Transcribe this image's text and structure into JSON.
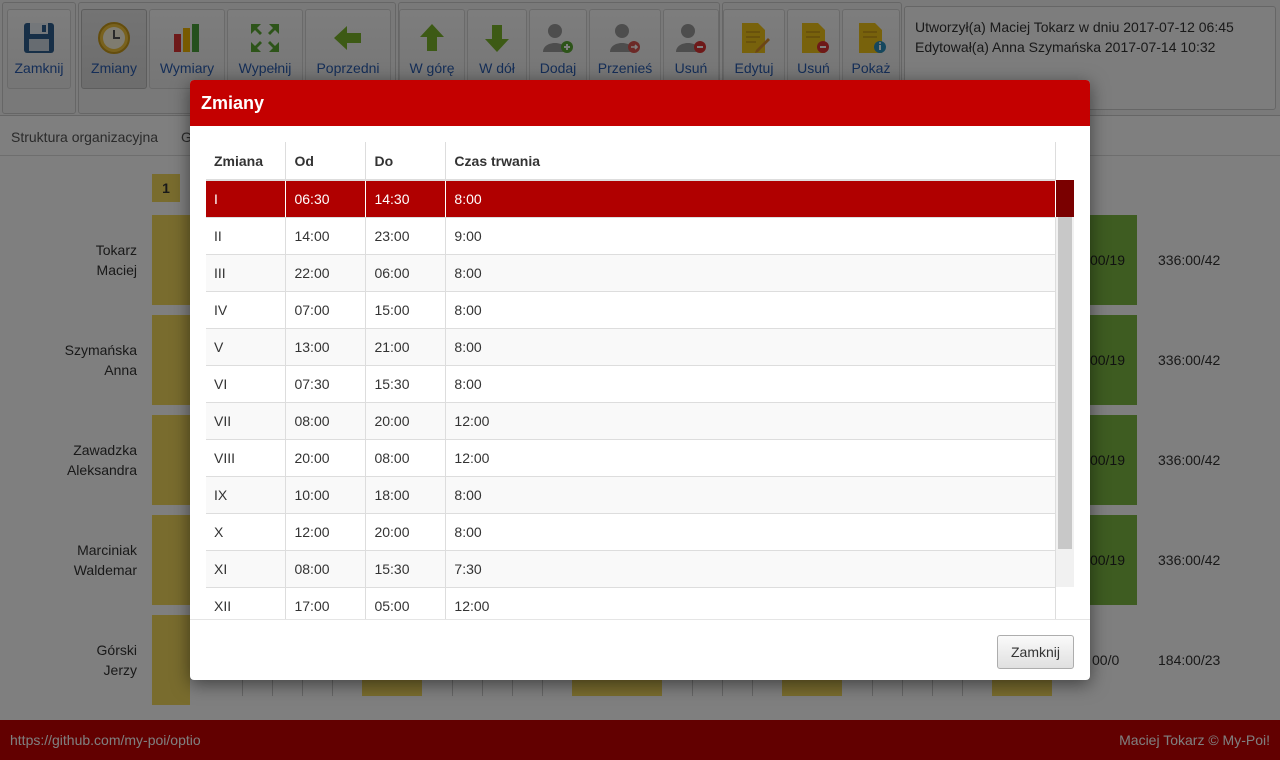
{
  "toolbar": {
    "buttons": [
      {
        "label": "Zamknij",
        "icon": "floppy-disk-icon"
      },
      {
        "label": "Zmiany",
        "icon": "clock-icon"
      },
      {
        "label": "Wymiary",
        "icon": "bar-chart-icon"
      },
      {
        "label": "Wypełnij",
        "icon": "expand-arrows-icon"
      },
      {
        "label": "Poprzedni",
        "icon": "arrow-left-icon"
      },
      {
        "label": "W górę",
        "icon": "arrow-up-icon"
      },
      {
        "label": "W dół",
        "icon": "arrow-down-icon"
      },
      {
        "label": "Dodaj",
        "icon": "user-add-icon"
      },
      {
        "label": "Przenieś",
        "icon": "user-move-icon"
      },
      {
        "label": "Usuń",
        "icon": "user-remove-icon"
      },
      {
        "label": "Edytuj",
        "icon": "doc-edit-icon"
      },
      {
        "label": "Usuń",
        "icon": "doc-remove-icon"
      },
      {
        "label": "Pokaż",
        "icon": "doc-info-icon"
      }
    ],
    "info": {
      "created": "Utworzył(a) Maciej Tokarz w dniu 2017-07-12 06:45",
      "edited": "Edytował(a) Anna Szymańska 2017-07-14 10:32"
    }
  },
  "tabs": [
    "Struktura organizacyjna",
    "G"
  ],
  "grid": {
    "day_badge": "1",
    "employees": [
      {
        "last": "Tokarz",
        "first": "Maciej",
        "value": "00/19",
        "total": "336:00/42"
      },
      {
        "last": "Szymańska",
        "first": "Anna",
        "value": "00/19",
        "total": "336:00/42"
      },
      {
        "last": "Zawadzka",
        "first": "Aleksandra",
        "value": "00/19",
        "total": "336:00/42"
      },
      {
        "last": "Marciniak",
        "first": "Waldemar",
        "value": "00/19",
        "total": "336:00/42"
      },
      {
        "last": "Górski",
        "first": "Jerzy",
        "value": "00/0",
        "total": "184:00/23"
      }
    ]
  },
  "modal": {
    "title": "Zmiany",
    "columns": [
      "Zmiana",
      "Od",
      "Do",
      "Czas trwania"
    ],
    "rows": [
      [
        "I",
        "06:30",
        "14:30",
        "8:00"
      ],
      [
        "II",
        "14:00",
        "23:00",
        "9:00"
      ],
      [
        "III",
        "22:00",
        "06:00",
        "8:00"
      ],
      [
        "IV",
        "07:00",
        "15:00",
        "8:00"
      ],
      [
        "V",
        "13:00",
        "21:00",
        "8:00"
      ],
      [
        "VI",
        "07:30",
        "15:30",
        "8:00"
      ],
      [
        "VII",
        "08:00",
        "20:00",
        "12:00"
      ],
      [
        "VIII",
        "20:00",
        "08:00",
        "12:00"
      ],
      [
        "IX",
        "10:00",
        "18:00",
        "8:00"
      ],
      [
        "X",
        "12:00",
        "20:00",
        "8:00"
      ],
      [
        "XI",
        "08:00",
        "15:30",
        "7:30"
      ],
      [
        "XII",
        "17:00",
        "05:00",
        "12:00"
      ]
    ],
    "selected_row": 0,
    "close_label": "Zamknij"
  },
  "footer": {
    "link": "https://github.com/my-poi/optio",
    "copyright": "Maciej Tokarz © My-Poi!"
  },
  "colors": {
    "accent": "#c40000",
    "selected_row": "#b00000",
    "shift_cell": "#f2d95c",
    "summary_cell": "#7cb842",
    "toolbar_label": "#2a5db0"
  }
}
